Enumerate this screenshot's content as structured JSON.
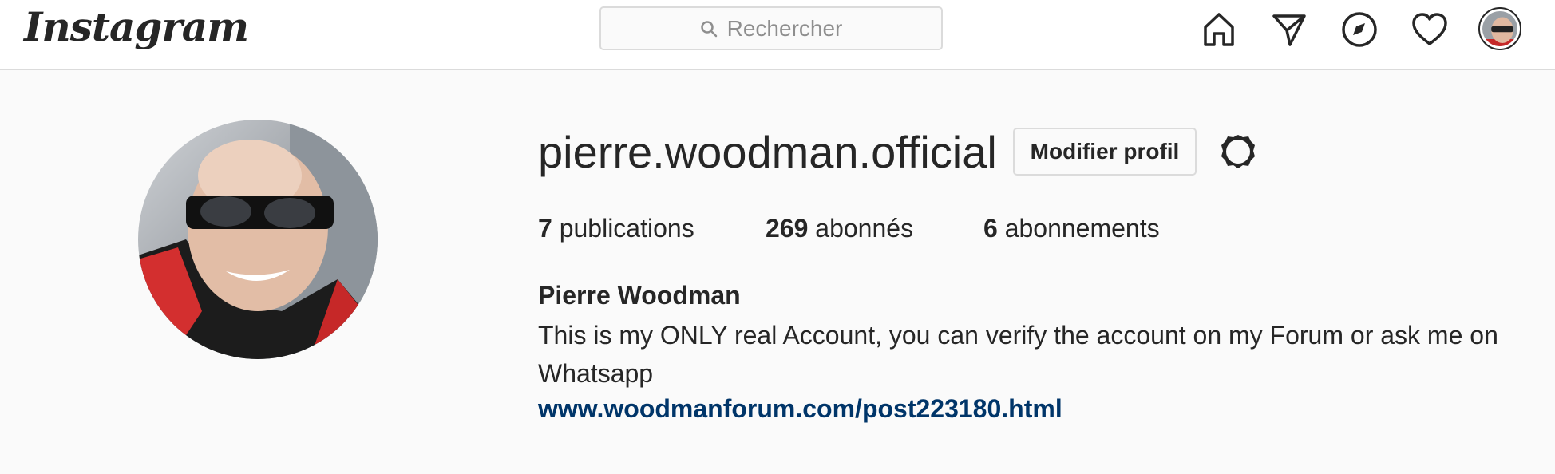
{
  "header": {
    "logo_text": "Instagram",
    "search_placeholder": "Rechercher",
    "icons": [
      "home-icon",
      "direct-message-icon",
      "explore-icon",
      "activity-heart-icon",
      "profile-avatar"
    ]
  },
  "profile": {
    "username": "pierre.woodman.official",
    "edit_button_label": "Modifier profil",
    "stats": {
      "posts_count": "7",
      "posts_label": "publications",
      "followers_count": "269",
      "followers_label": "abonnés",
      "following_count": "6",
      "following_label": "abonnements"
    },
    "full_name": "Pierre Woodman",
    "bio": "This is my ONLY real Account, you can verify the account on my Forum or ask me on Whatsapp",
    "website": "www.woodmanforum.com/post223180.html"
  },
  "colors": {
    "background": "#fafafa",
    "text": "#262626",
    "border": "#dbdbdb",
    "link": "#003569",
    "muted": "#8e8e8e"
  }
}
